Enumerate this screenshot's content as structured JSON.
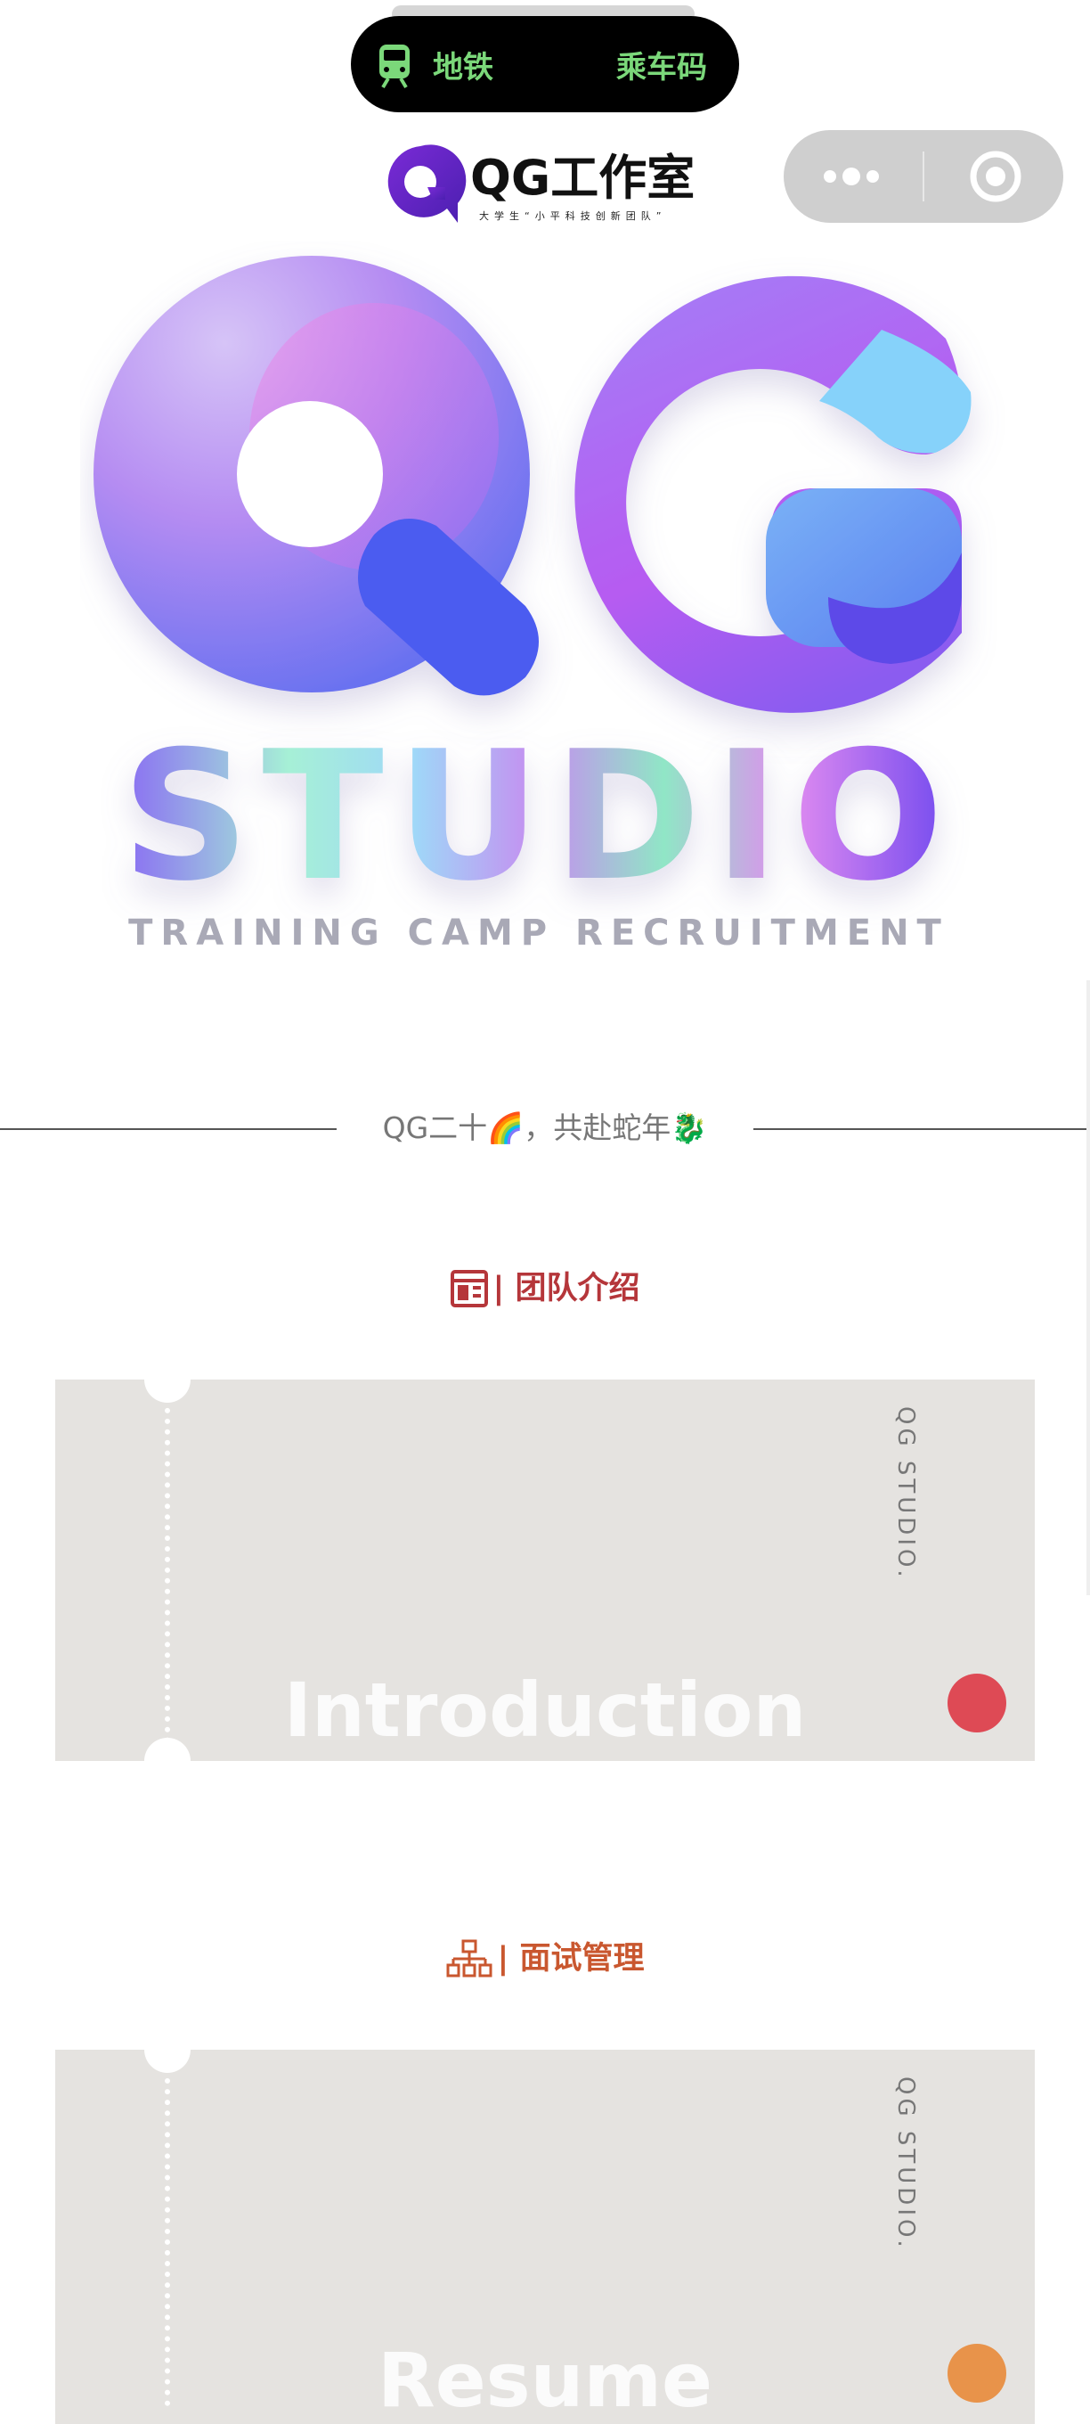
{
  "status_bar": {
    "metro_label": "地铁",
    "ride_code_label": "乘车码",
    "metro_color": "#7bd87a"
  },
  "header": {
    "logo_text": "QG工作室",
    "logo_tagline": "大学生“小平科技创新团队”",
    "brand_color": "#5b2bc7"
  },
  "hero": {
    "big_letters": "QG",
    "word": "STUDIO",
    "subtitle": "TRAINING CAMP RECRUITMENT"
  },
  "slogan": {
    "text": "QG二十🌈，共赴蛇年🐉"
  },
  "sections": [
    {
      "title": "| 团队介绍",
      "icon": "layout-icon",
      "color": "#b5363a",
      "card": {
        "vertical_text": "QG STUDIO.",
        "big_text": "Introduction",
        "dot_color": "#de4a55"
      }
    },
    {
      "title": "| 面试管理",
      "icon": "org-chart-icon",
      "color": "#c9572f",
      "card": {
        "vertical_text": "QG STUDIO.",
        "big_text": "Resume",
        "dot_color": "#e8934a"
      }
    }
  ]
}
